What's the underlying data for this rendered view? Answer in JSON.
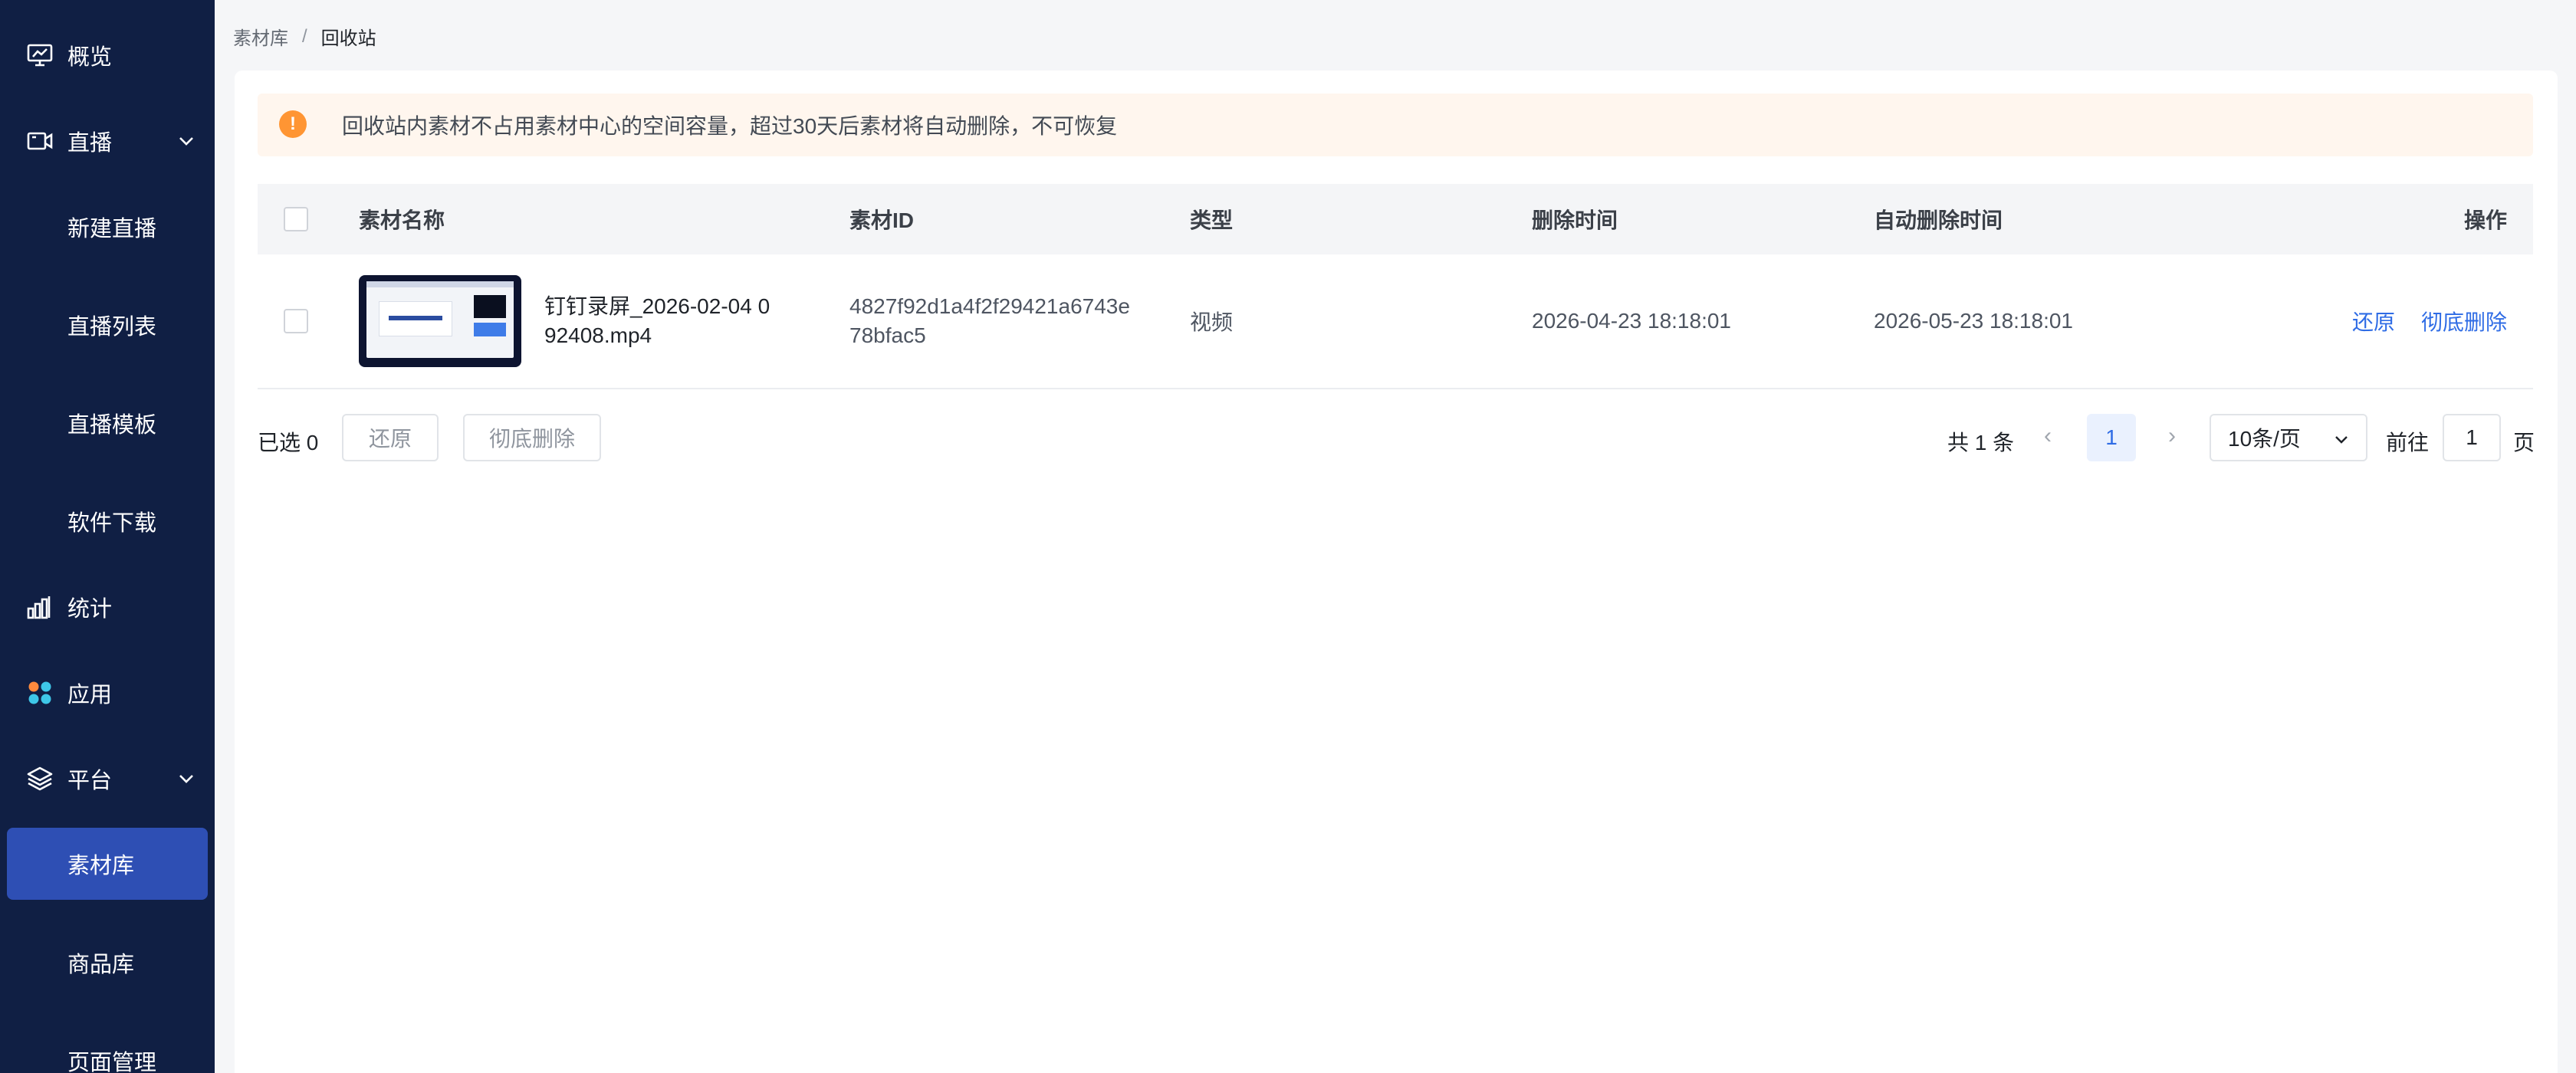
{
  "sidebar": {
    "items": [
      {
        "label": "概览",
        "icon": "monitor-chart-icon"
      },
      {
        "label": "直播",
        "icon": "video-camera-icon",
        "expanded": true
      },
      {
        "label": "新建直播"
      },
      {
        "label": "直播列表"
      },
      {
        "label": "直播模板"
      },
      {
        "label": "软件下载"
      },
      {
        "label": "统计",
        "icon": "bar-chart-icon"
      },
      {
        "label": "应用",
        "icon": "apps-grid-icon"
      },
      {
        "label": "平台",
        "icon": "layers-icon",
        "expanded": true
      },
      {
        "label": "素材库",
        "active": true
      },
      {
        "label": "商品库"
      },
      {
        "label": "页面管理"
      }
    ],
    "active_color": "#2e4fb4",
    "background": "#101f44"
  },
  "breadcrumb": {
    "parent": "素材库",
    "separator": "/",
    "current": "回收站"
  },
  "alert": {
    "text": "回收站内素材不占用素材中心的空间容量，超过30天后素材将自动删除，不可恢复",
    "icon": "warning-circle-icon",
    "icon_symbol": "!"
  },
  "table": {
    "columns": {
      "name": "素材名称",
      "id": "素材ID",
      "type": "类型",
      "deleted_at": "删除时间",
      "auto_delete_at": "自动删除时间",
      "actions": "操作"
    },
    "rows": [
      {
        "name": "钉钉录屏_2026-02-04 092408.mp4",
        "id": "4827f92d1a4f2f29421a6743e78bfac5",
        "type": "视频",
        "deleted_at": "2026-04-23 18:18:01",
        "auto_delete_at": "2026-05-23 18:18:01",
        "restore_label": "还原",
        "delete_label": "彻底删除"
      }
    ]
  },
  "footer": {
    "selected_label": "已选 0",
    "restore_label": "还原",
    "delete_label": "彻底删除",
    "total_label": "共 1 条",
    "prev_symbol": "‹",
    "current_page": "1",
    "next_symbol": "›",
    "page_size": "10条/页",
    "goto_prefix": "前往",
    "goto_value": "1",
    "goto_suffix": "页"
  }
}
